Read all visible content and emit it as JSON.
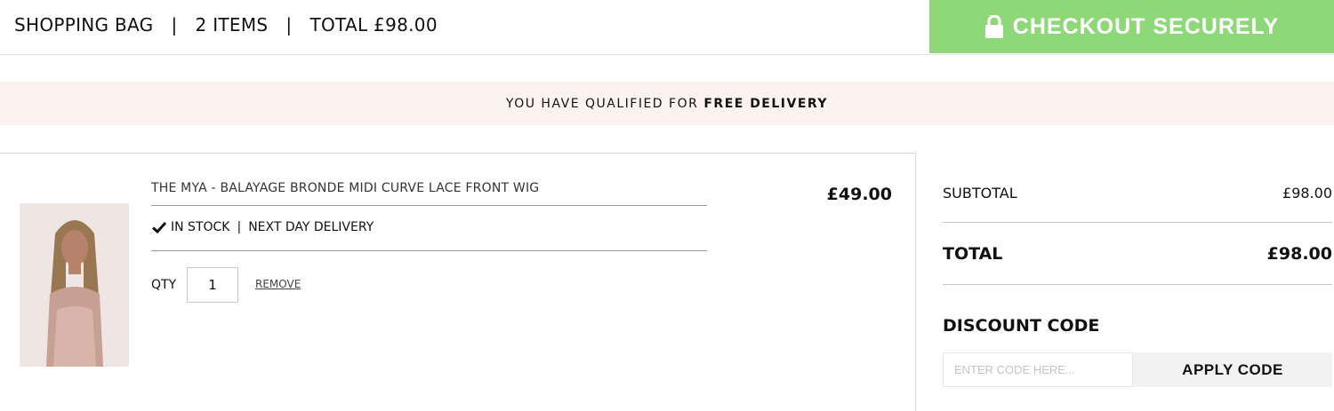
{
  "header": {
    "title": "SHOPPING BAG",
    "separator": "|",
    "item_count": "2 ITEMS",
    "total": "TOTAL £98.00",
    "checkout_label": "CHECKOUT SECURELY"
  },
  "banner": {
    "text": "YOU HAVE QUALIFIED FOR",
    "highlight": "FREE DELIVERY"
  },
  "cart": {
    "items": [
      {
        "title": "THE MYA - BALAYAGE BRONDE MIDI CURVE LACE FRONT WIG",
        "stock": "IN STOCK",
        "stock_separator": "|",
        "delivery": "NEXT DAY DELIVERY",
        "qty_label": "QTY",
        "qty": "1",
        "remove_label": "REMOVE",
        "price": "£49.00"
      }
    ]
  },
  "summary": {
    "subtotal_label": "SUBTOTAL",
    "subtotal_value": "£98.00",
    "total_label": "TOTAL",
    "total_value": "£98.00",
    "discount_title": "DISCOUNT CODE",
    "discount_placeholder": "ENTER CODE HERE...",
    "apply_label": "APPLY CODE"
  },
  "colors": {
    "checkout_green": "#8fd87a",
    "banner_bg": "#fdf2ef",
    "apply_bg": "#f2f2f2"
  },
  "icons": [
    "lock-icon",
    "checkmark-icon"
  ]
}
